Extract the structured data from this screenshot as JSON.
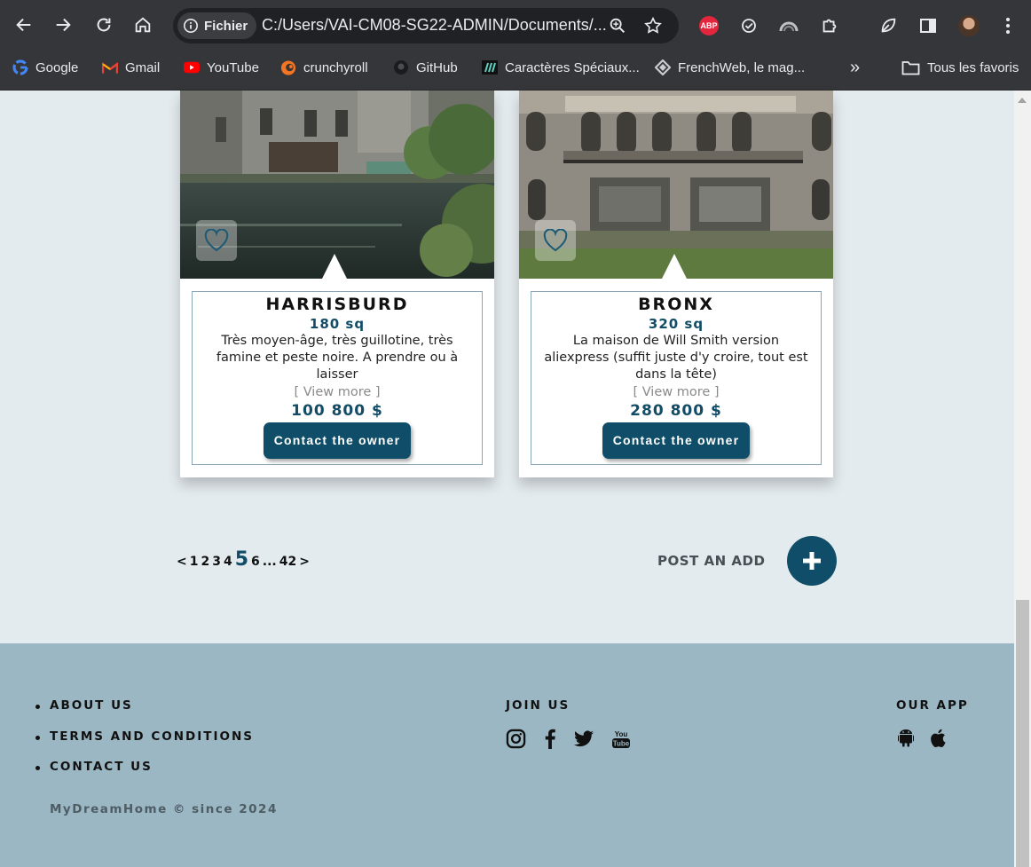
{
  "browser": {
    "site_chip_label": "Fichier",
    "url": "C:/Users/VAI-CM08-SG22-ADMIN/Documents/...",
    "bookmarks": [
      {
        "label": "Google",
        "icon": "google-icon"
      },
      {
        "label": "Gmail",
        "icon": "gmail-icon"
      },
      {
        "label": "YouTube",
        "icon": "youtube-icon"
      },
      {
        "label": "crunchyroll",
        "icon": "crunchyroll-icon"
      },
      {
        "label": "GitHub",
        "icon": "github-icon"
      },
      {
        "label": "Caractères Spéciaux...",
        "icon": "special-chars-icon"
      },
      {
        "label": "FrenchWeb, le mag...",
        "icon": "frenchweb-icon"
      }
    ],
    "bookmarks_overflow": "»",
    "all_bookmarks_label": "Tous les favoris",
    "abp_label": "ABP"
  },
  "listings": [
    {
      "title": "HARRISBURD",
      "size": "180 sq",
      "description": "Très moyen-âge, très guillotine, très famine et peste noire. A prendre ou à laisser",
      "view_more": "[ View more ]",
      "price": "100 800 $",
      "contact_label": "Contact the owner"
    },
    {
      "title": "BRONX",
      "size": "320 sq",
      "description": "La maison de Will Smith version aliexpress (suffit juste d'y croire, tout est dans la tête)",
      "view_more": "[ View more ]",
      "price": "280 800 $",
      "contact_label": "Contact the owner"
    }
  ],
  "pagination": {
    "prev": "<",
    "pages_before": [
      "1",
      "2",
      "3",
      "4"
    ],
    "current": "5",
    "pages_after": [
      "6"
    ],
    "ellipsis": "...",
    "last": "42",
    "next": ">"
  },
  "post_ad": {
    "label": "POST AN ADD",
    "button_icon": "plus-icon"
  },
  "footer": {
    "links": [
      "ABOUT US",
      "TERMS AND CONDITIONS",
      "CONTACT US"
    ],
    "join_heading": "JOIN US",
    "social_icons": [
      "instagram-icon",
      "facebook-icon",
      "twitter-icon",
      "youtube-icon"
    ],
    "app_heading": "OUR APP",
    "app_icons": [
      "android-icon",
      "apple-icon"
    ],
    "copyright": "MyDreamHome © since 2024"
  },
  "colors": {
    "brand": "#0f4d69",
    "page_background": "#e4ebef",
    "footer_background": "#9bb7c3",
    "chrome_background": "#35363a"
  }
}
